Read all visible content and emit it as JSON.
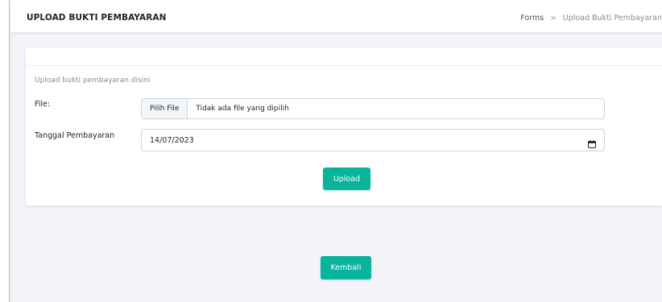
{
  "header": {
    "title": "UPLOAD BUKTI PEMBAYARAN",
    "breadcrumb": {
      "parent": "Forms",
      "separator": ">",
      "current": "Upload Bukti Pembayaran"
    }
  },
  "form": {
    "subtitle": "Upload bukti pembayaran disini",
    "file_label": "File:",
    "file_button_label": "Pilih File",
    "file_status": "Tidak ada file yang dipilih",
    "date_label": "Tanggal Pembayaran",
    "date_value": "14/07/2023",
    "upload_button_label": "Upload"
  },
  "footer": {
    "back_button_label": "Kembali"
  },
  "colors": {
    "accent": "#0ab39c",
    "page_background": "#f3f3f9",
    "card_background": "#ffffff"
  },
  "icons": {
    "date_picker": "calendar-icon"
  }
}
